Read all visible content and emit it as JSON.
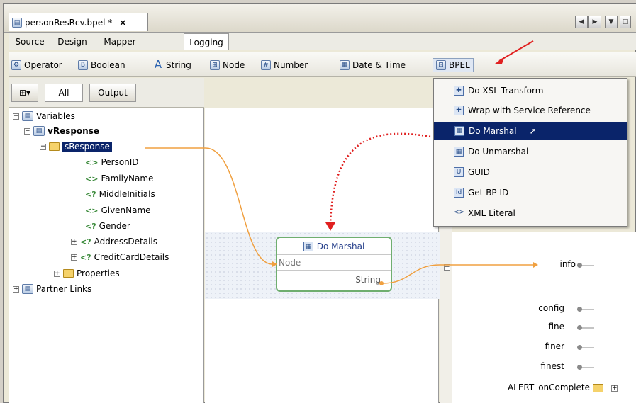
{
  "file_tab": {
    "title": "personResRcv.bpel *",
    "close": "×"
  },
  "view_tabs": [
    "Source",
    "Design",
    "Mapper",
    "Logging"
  ],
  "palette": [
    "Operator",
    "Boolean",
    "String",
    "Node",
    "Number",
    "Date & Time",
    "BPEL"
  ],
  "left_tools": {
    "all": "All",
    "output": "Output"
  },
  "tree": {
    "variables": "Variables",
    "vresponse": "vResponse",
    "sresponse": "sResponse",
    "children": [
      "PersonID",
      "FamilyName",
      "MiddleInitials",
      "GivenName",
      "Gender",
      "AddressDetails",
      "CreditCardDetails"
    ],
    "properties": "Properties",
    "partner_links": "Partner Links"
  },
  "marshal_box": {
    "title": "Do Marshal",
    "input": "Node",
    "output": "String"
  },
  "menu": [
    "Do XSL Transform",
    "Wrap with Service Reference",
    "Do Marshal",
    "Do Unmarshal",
    "GUID",
    "Get BP ID",
    "XML Literal"
  ],
  "right": {
    "info": "info",
    "config": "config",
    "fine": "fine",
    "finer": "finer",
    "finest": "finest",
    "alert": "ALERT_onComplete"
  },
  "colors": {
    "selection": "#0a246a",
    "link": "#f0a040",
    "arrow": "#e02020",
    "marshal_border": "#6fae6f"
  }
}
